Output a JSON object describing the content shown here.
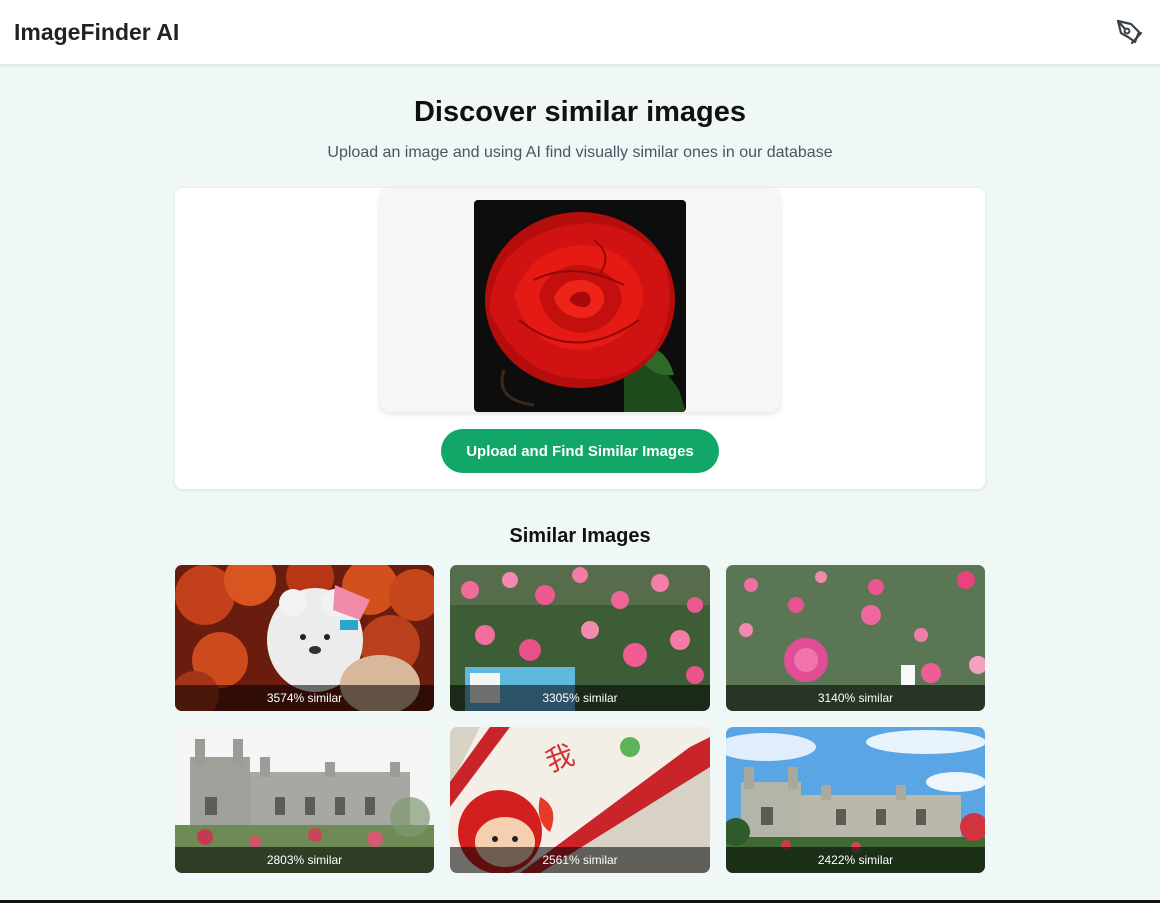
{
  "app": {
    "title": "ImageFinder AI",
    "action_icon": "pen-tool-icon"
  },
  "hero": {
    "title": "Discover similar images",
    "subtitle": "Upload an image and using AI find visually similar ones in our database"
  },
  "upload": {
    "preview_alt": "red rose",
    "button_label": "Upload and Find Similar Images",
    "button_color": "#12a669"
  },
  "results": {
    "title": "Similar Images",
    "items": [
      {
        "label": "3574% similar",
        "subject": "orange roses with white teddy bear"
      },
      {
        "label": "3305% similar",
        "subject": "pink rose bush"
      },
      {
        "label": "3140% similar",
        "subject": "pink roses in garden"
      },
      {
        "label": "2803% similar",
        "subject": "gothic building with garden"
      },
      {
        "label": "2561% similar",
        "subject": "red plush toy and calligraphy frame"
      },
      {
        "label": "2422% similar",
        "subject": "gothic building under blue sky"
      }
    ]
  }
}
